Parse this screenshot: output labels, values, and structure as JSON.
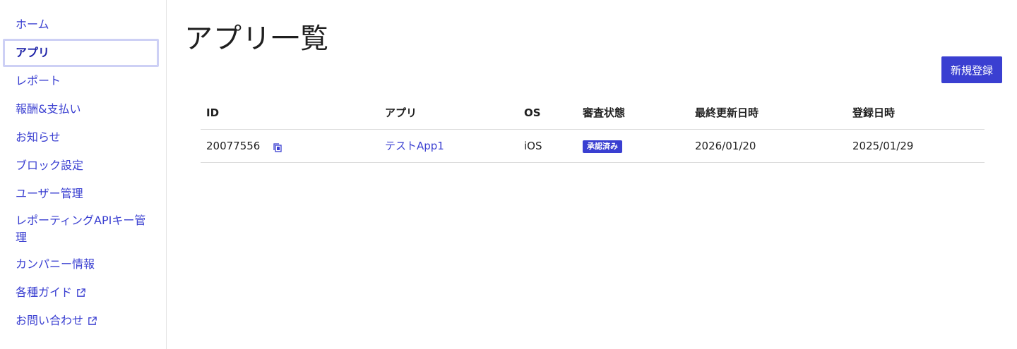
{
  "sidebar": {
    "items": [
      {
        "label": "ホーム"
      },
      {
        "label": "アプリ"
      },
      {
        "label": "レポート"
      },
      {
        "label": "報酬&支払い"
      },
      {
        "label": "お知らせ"
      },
      {
        "label": "ブロック設定"
      },
      {
        "label": "ユーザー管理"
      },
      {
        "label": "レポーティングAPIキー管理"
      },
      {
        "label": "カンパニー情報"
      },
      {
        "label": "各種ガイド"
      },
      {
        "label": "お問い合わせ"
      }
    ]
  },
  "main": {
    "title": "アプリ一覧",
    "new_button": "新規登録",
    "table": {
      "headers": [
        "ID",
        "アプリ",
        "OS",
        "審査状態",
        "最終更新日時",
        "登録日時"
      ],
      "rows": [
        {
          "id": "20077556",
          "app": "テストApp1",
          "os": "iOS",
          "status": "承認済み",
          "updated": "2026/01/20",
          "registered": "2025/01/29"
        }
      ]
    }
  },
  "colors": {
    "accent": "#3a3fd1",
    "active_border": "#cdd0f5"
  }
}
